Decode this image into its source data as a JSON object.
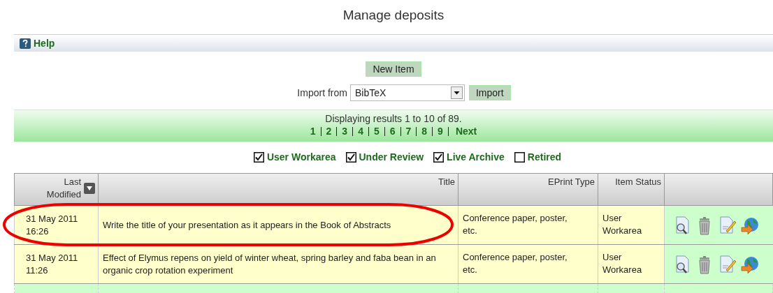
{
  "page_title": "Manage deposits",
  "help": {
    "label": "Help"
  },
  "new_item_button": "New Item",
  "import": {
    "label": "Import from",
    "format": "BibTeX",
    "button": "Import"
  },
  "pager": {
    "summary": "Displaying results 1 to 10 of 89.",
    "pages": [
      "1",
      "2",
      "3",
      "4",
      "5",
      "6",
      "7",
      "8",
      "9"
    ],
    "next": "Next"
  },
  "filters": [
    {
      "label": "User Workarea",
      "checked": true
    },
    {
      "label": "Under Review",
      "checked": true
    },
    {
      "label": "Live Archive",
      "checked": true
    },
    {
      "label": "Retired",
      "checked": false
    }
  ],
  "table": {
    "columns": [
      "Last Modified",
      "Title",
      "EPrint Type",
      "Item Status"
    ],
    "rows": [
      {
        "last_modified": [
          "31 May 2011",
          "16:26"
        ],
        "title": "Write the title of your presentation as it appears in the Book of Abstracts",
        "eprint_type": "Conference paper, poster, etc.",
        "item_status": "User Workarea"
      },
      {
        "last_modified": [
          "31 May 2011",
          "11:26"
        ],
        "title": "Effect of Elymus repens on yield of winter wheat, spring barley and faba bean in an organic crop rotation experiment",
        "eprint_type": "Conference paper, poster, etc.",
        "item_status": "User Workarea"
      }
    ]
  }
}
